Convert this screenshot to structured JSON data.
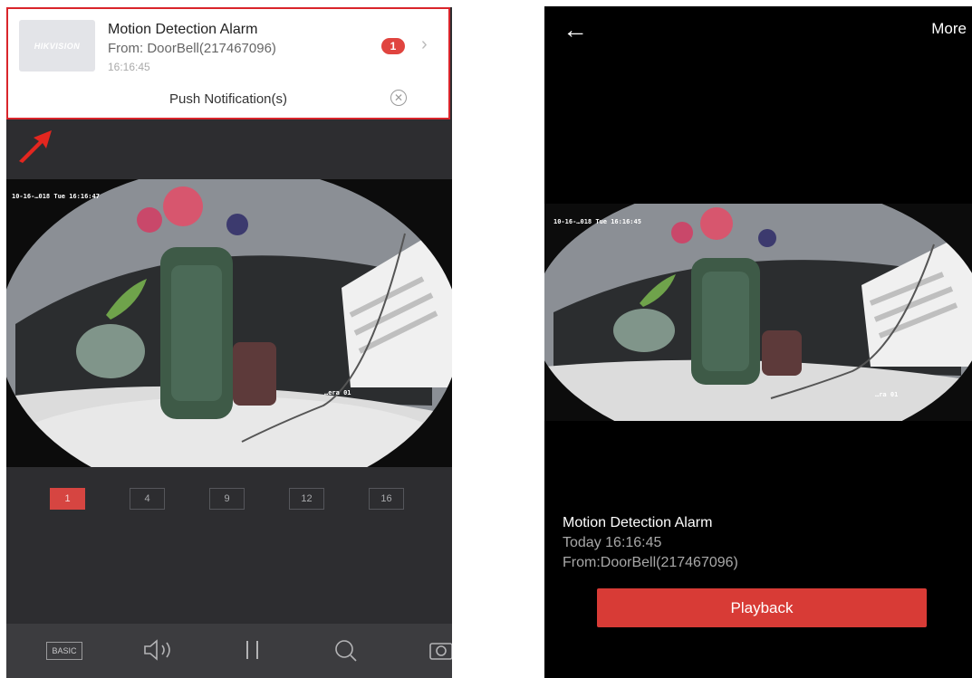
{
  "notification": {
    "thumbnail_logo": "HIKVISION",
    "title": "Motion Detection Alarm",
    "from": "From: DoorBell(217467096)",
    "time": "16:16:45",
    "badge_count": "1",
    "chevron_icon": "chevron-right-icon",
    "footer_label": "Push Notification(s)",
    "close_icon": "close-circle-icon",
    "highlight_color": "#d9252b"
  },
  "live_view": {
    "osd_timestamp": "10-16-…018 Tue 16:16:47",
    "camera_label": "…era 01",
    "grid_options": [
      {
        "label": "1",
        "active": true
      },
      {
        "label": "4",
        "active": false
      },
      {
        "label": "9",
        "active": false
      },
      {
        "label": "12",
        "active": false
      },
      {
        "label": "16",
        "active": false
      }
    ],
    "toolbar": {
      "basic_label": "BASIC",
      "icons": [
        "quality-basic-icon",
        "speaker-icon",
        "pause-icon",
        "zoom-icon",
        "camera-icon"
      ]
    }
  },
  "alarm_detail": {
    "back_icon": "arrow-left-icon",
    "more_label": "More",
    "osd_timestamp": "10-16-…018 Tue 16:16:45",
    "camera_label": "…ra 01",
    "title": "Motion Detection Alarm",
    "time": "Today 16:16:45",
    "from": "From:DoorBell(217467096)",
    "playback_label": "Playback",
    "accent_color": "#d83b36"
  }
}
